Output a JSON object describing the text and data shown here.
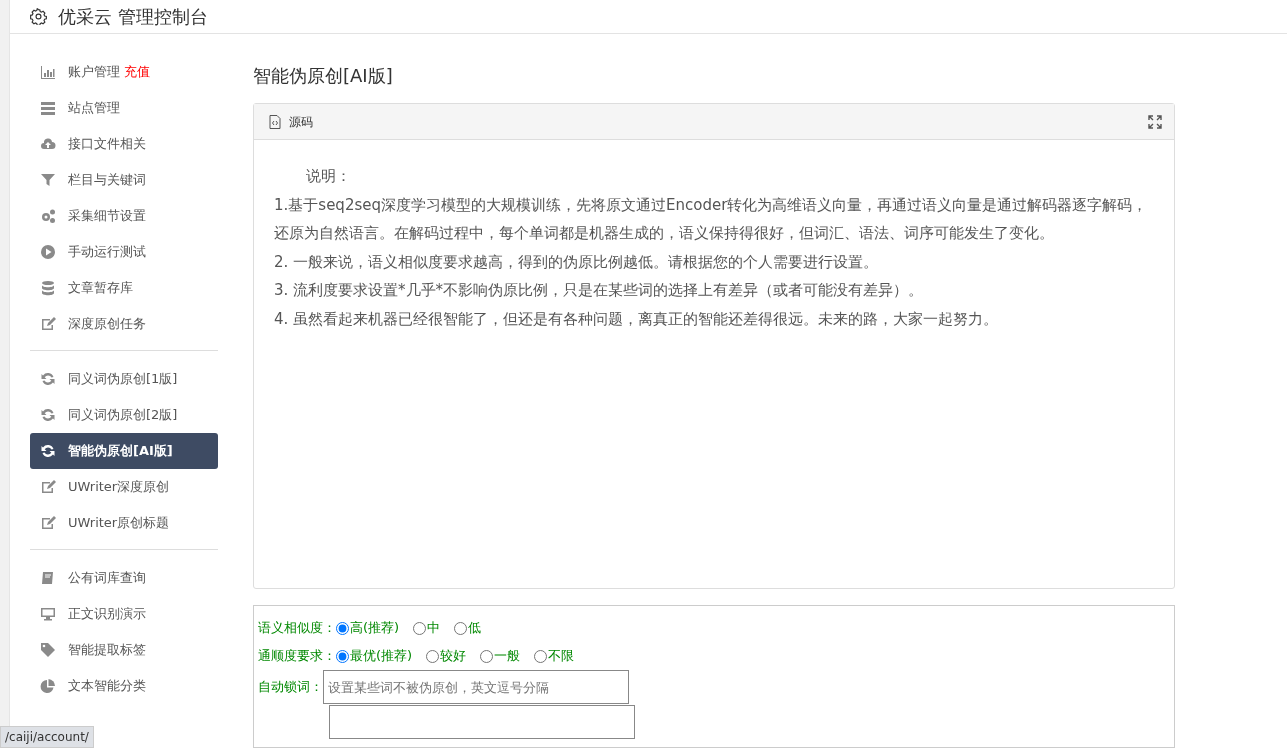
{
  "header": {
    "title": "优采云 管理控制台"
  },
  "sidebar": {
    "groups": [
      {
        "items": [
          {
            "label": "账户管理",
            "badge": "充值",
            "selected": false
          },
          {
            "label": "站点管理",
            "selected": false
          },
          {
            "label": "接口文件相关",
            "selected": false
          },
          {
            "label": "栏目与关键词",
            "selected": false
          },
          {
            "label": "采集细节设置",
            "selected": false
          },
          {
            "label": "手动运行测试",
            "selected": false
          },
          {
            "label": "文章暂存库",
            "selected": false
          },
          {
            "label": "深度原创任务",
            "selected": false
          }
        ]
      },
      {
        "items": [
          {
            "label": "同义词伪原创[1版]",
            "selected": false
          },
          {
            "label": "同义词伪原创[2版]",
            "selected": false
          },
          {
            "label": "智能伪原创[AI版]",
            "selected": true
          },
          {
            "label": "UWriter深度原创",
            "selected": false
          },
          {
            "label": "UWriter原创标题",
            "selected": false
          }
        ]
      },
      {
        "items": [
          {
            "label": "公有词库查询",
            "selected": false
          },
          {
            "label": "正文识别演示",
            "selected": false
          },
          {
            "label": "智能提取标签",
            "selected": false
          },
          {
            "label": "文本智能分类",
            "selected": false
          }
        ]
      }
    ]
  },
  "page_title": "智能伪原创[AI版]",
  "editor": {
    "toolbar_label": "源码",
    "paragraphs": [
      "说明：",
      "1.基于seq2seq深度学习模型的大规模训练，先将原文通过Encoder转化为高维语义向量，再通过语义向量是通过解码器逐字解码，还原为自然语言。在解码过程中，每个单词都是机器生成的，语义保持得很好，但词汇、语法、词序可能发生了变化。",
      "2. 一般来说，语义相似度要求越高，得到的伪原比例越低。请根据您的个人需要进行设置。",
      "3. 流利度要求设置*几乎*不影响伪原比例，只是在某些词的选择上有差异（或者可能没有差异）。",
      "4. 虽然看起来机器已经很智能了，但还是有各种问题，离真正的智能还差得很远。未来的路，大家一起努力。"
    ]
  },
  "form": {
    "rows": [
      {
        "kind": "radio",
        "label": "语义相似度：",
        "options": [
          {
            "label": "高(推荐)",
            "selected": true
          },
          {
            "label": "中",
            "selected": false
          },
          {
            "label": "低",
            "selected": false
          }
        ]
      },
      {
        "kind": "radio",
        "label": "通顺度要求：",
        "options": [
          {
            "label": "最优(推荐)",
            "selected": true
          },
          {
            "label": "较好",
            "selected": false
          },
          {
            "label": "一般",
            "selected": false
          },
          {
            "label": "不限",
            "selected": false
          }
        ]
      },
      {
        "kind": "text",
        "label": "自动锁词：",
        "placeholder": "设置某些词不被伪原创，英文逗号分隔"
      }
    ]
  },
  "status_url": "/caiji/account/"
}
